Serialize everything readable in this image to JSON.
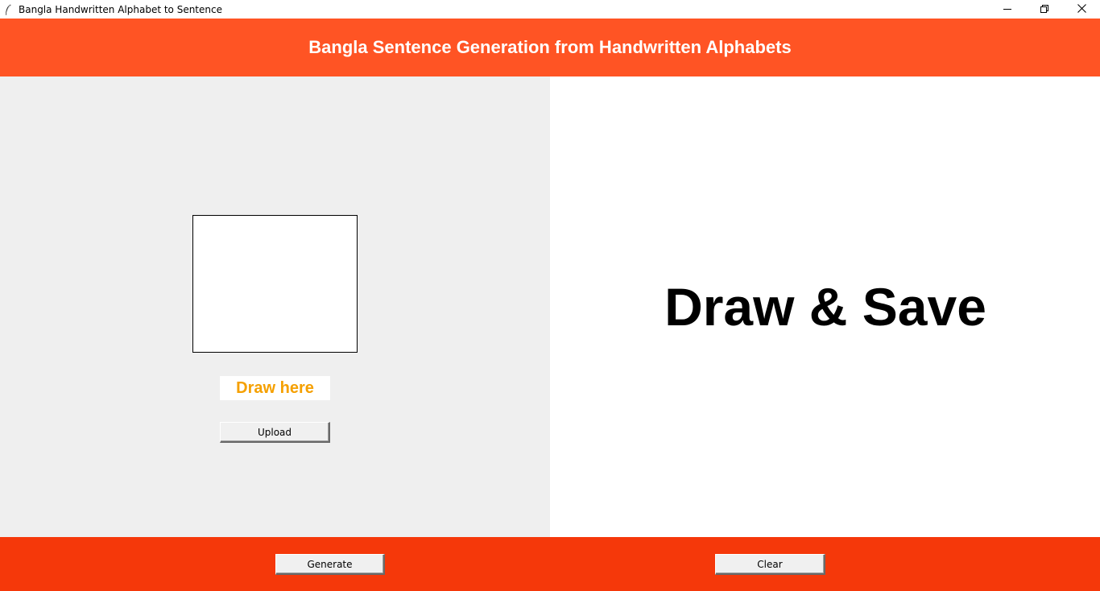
{
  "window": {
    "title": "Bangla Handwritten Alphabet to Sentence",
    "icon": "feather-icon",
    "controls": [
      "minimize-icon",
      "restore-icon",
      "close-icon"
    ]
  },
  "header": {
    "title": "Bangla Sentence Generation from Handwritten Alphabets"
  },
  "left_panel": {
    "draw_label": "Draw here",
    "upload_label": "Upload"
  },
  "right_panel": {
    "status_text": "Draw & Save"
  },
  "footer": {
    "generate_label": "Generate",
    "clear_label": "Clear"
  },
  "colors": {
    "header_bg": "#ff5424",
    "footer_bg": "#f5380a",
    "left_panel_bg": "#efefef",
    "right_panel_bg": "#ffffff",
    "draw_label_color": "#f5a000"
  }
}
